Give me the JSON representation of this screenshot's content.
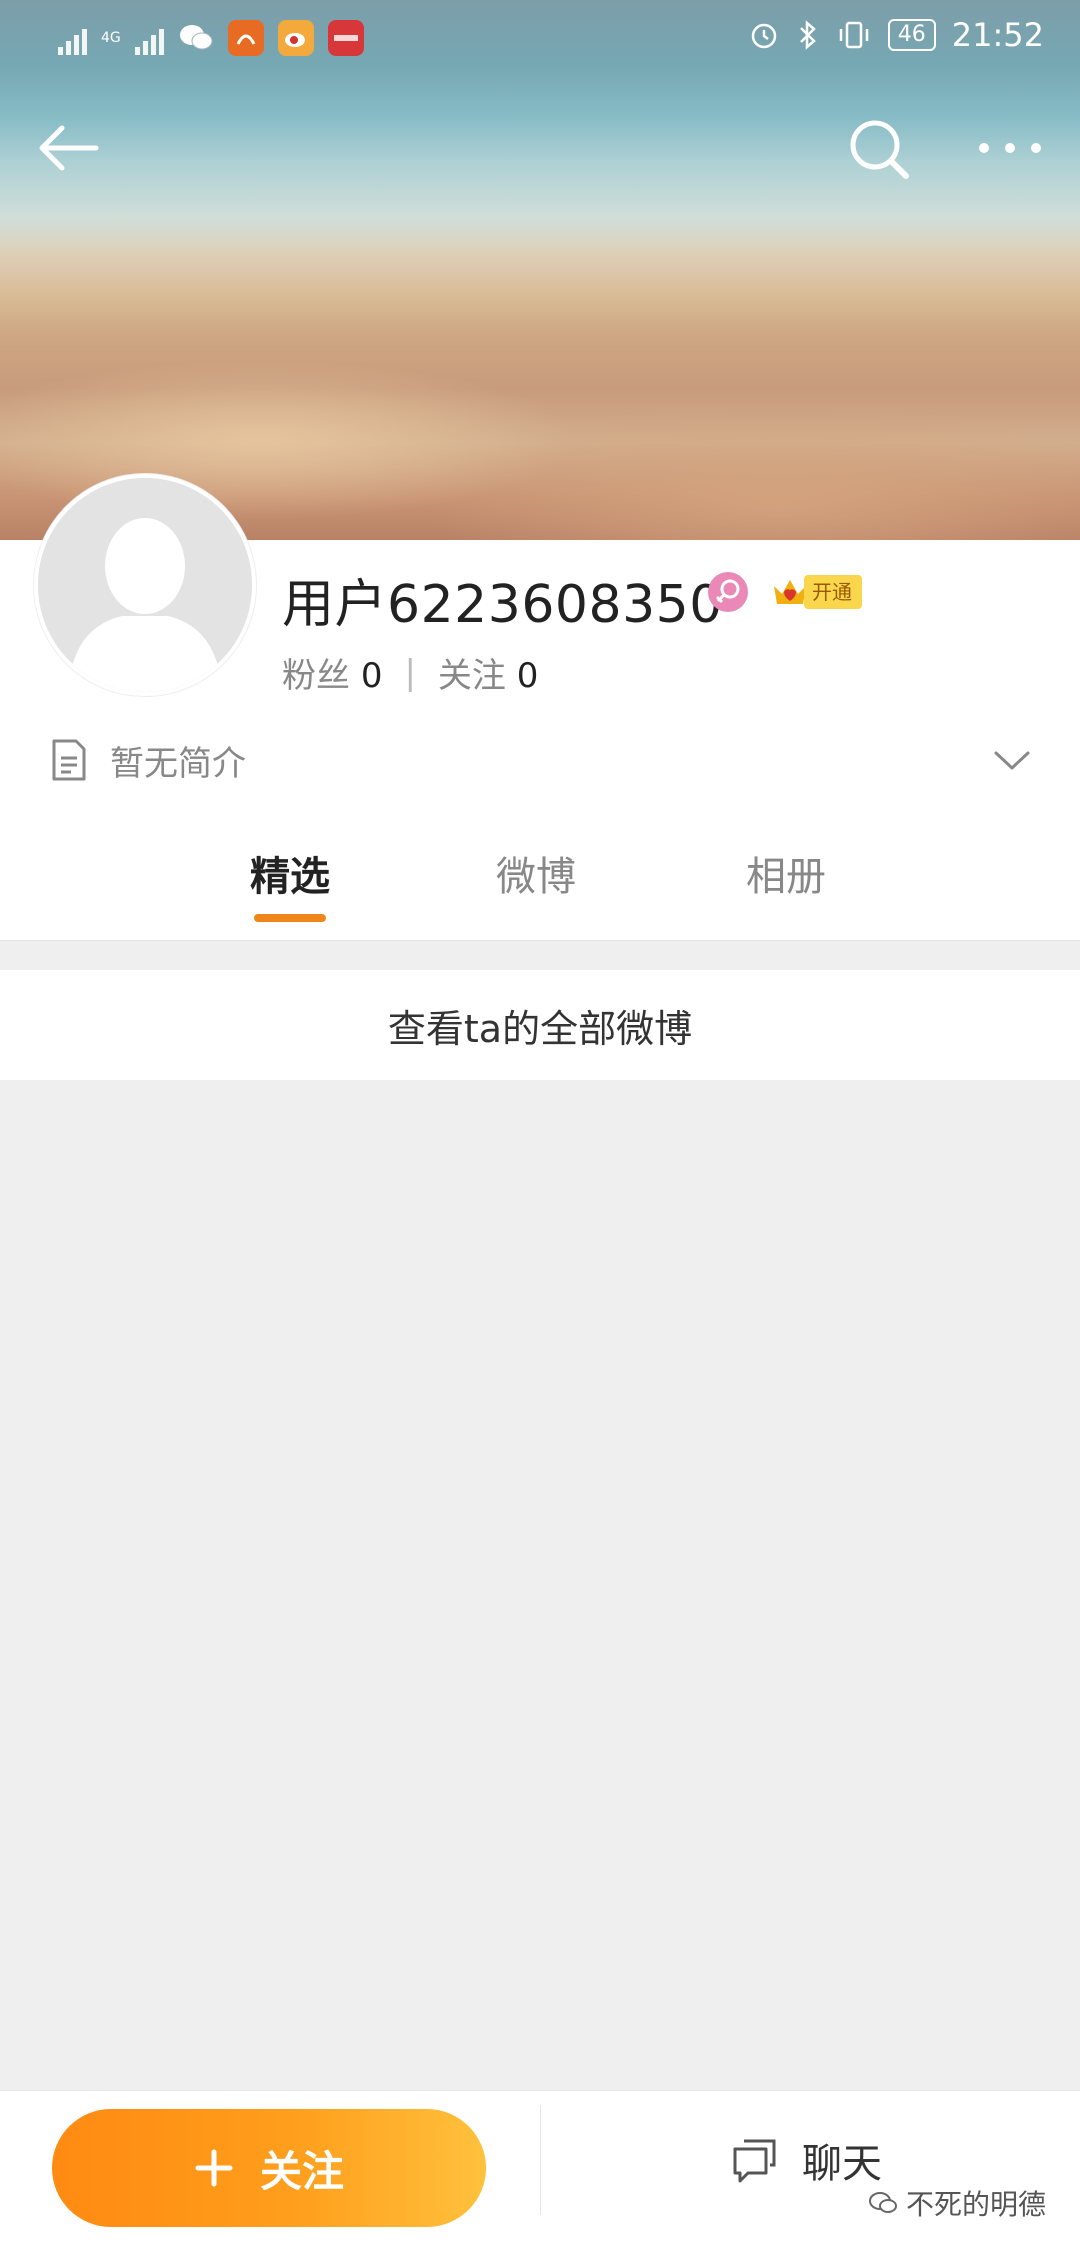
{
  "statusbar": {
    "network": "4G",
    "battery": "46",
    "time": "21:52",
    "apps": [
      "wechat-icon",
      "uc-browser-icon",
      "weibo-icon",
      "news-app-icon"
    ]
  },
  "profile": {
    "username": "用户6223608350",
    "vip_badge": "开通",
    "fans_label": "粉丝",
    "fans_count": "0",
    "follow_label": "关注",
    "follow_count": "0",
    "intro": "暂无简介"
  },
  "tabs": [
    {
      "label": "精选",
      "active": true
    },
    {
      "label": "微博",
      "active": false
    },
    {
      "label": "相册",
      "active": false
    }
  ],
  "content": {
    "all_weibo_link": "查看ta的全部微博"
  },
  "bottombar": {
    "follow_button": "关注",
    "chat_button": "聊天",
    "watermark": "不死的明德"
  },
  "colors": {
    "accent": "#f08519",
    "follow_gradient_start": "#ff8a12",
    "follow_gradient_end": "#ffc13c",
    "gender_female": "#ea89b7",
    "vip_gold": "#f9d64c"
  }
}
